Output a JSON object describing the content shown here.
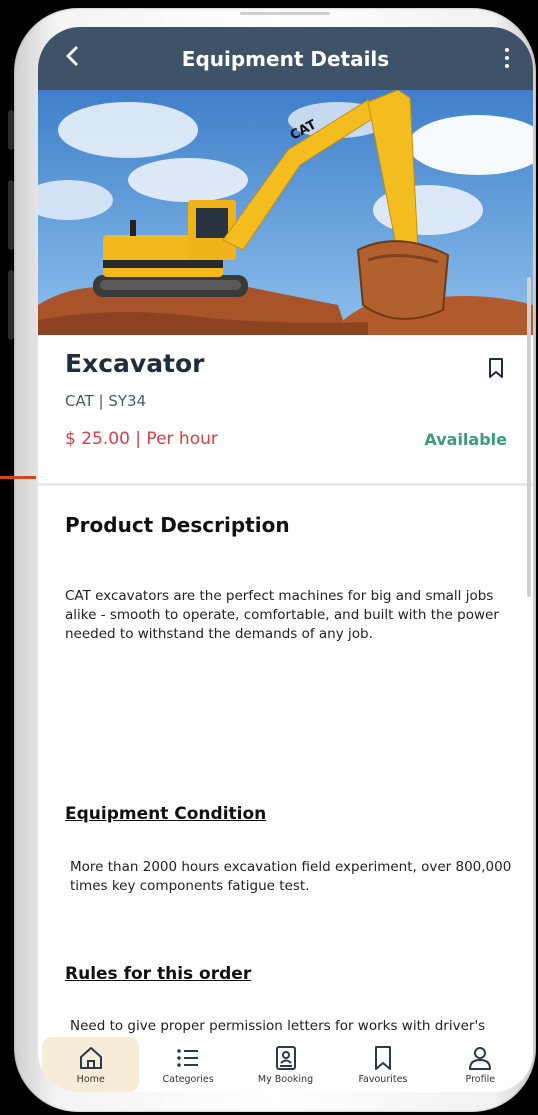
{
  "header": {
    "title": "Equipment Details",
    "back_icon": "chevron-left-icon",
    "menu_icon": "more-vertical-icon"
  },
  "hero": {
    "brand_marking": "CAT"
  },
  "equipment": {
    "name": "Excavator",
    "brand_model": "CAT | SY34",
    "price": "$ 25.00 | Per hour",
    "status": "Available",
    "bookmark_icon": "bookmark-icon"
  },
  "sections": {
    "description_title": "Product Description",
    "description_text": "CAT excavators are the perfect machines for big and small jobs alike - smooth to operate, comfortable, and built with the power needed to withstand the demands of any job.",
    "condition_title": "Equipment Condition",
    "condition_text": "More than 2000 hours excavation field experiment, over 800,000 times key components fatigue test.",
    "rules_title": "Rules for this order",
    "rules_text": "Need to give proper permission letters for works with driver's"
  },
  "nav": {
    "items": [
      {
        "label": "Home",
        "icon": "home-icon",
        "active": true
      },
      {
        "label": "Categories",
        "icon": "list-icon",
        "active": false
      },
      {
        "label": "My Booking",
        "icon": "booking-icon",
        "active": false
      },
      {
        "label": "Favourites",
        "icon": "bookmark-icon",
        "active": false
      },
      {
        "label": "Profile",
        "icon": "user-icon",
        "active": false
      }
    ]
  },
  "colors": {
    "header_bg": "#3e5268",
    "price": "#d1414c",
    "status": "#3b9c7c",
    "nav_active_bg": "#f5edd9"
  }
}
